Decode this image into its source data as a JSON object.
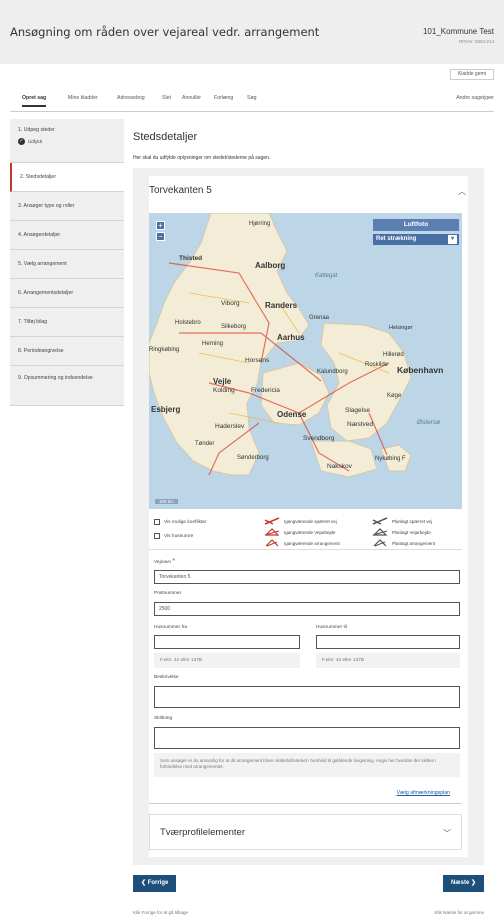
{
  "header": {
    "title": "Ansøgning om råden over vejareal vedr. arrangement",
    "user": "101_Kommune Test",
    "subuser": "RDVnr: 0004-214"
  },
  "kladde_button": "Kladde gemt",
  "nav": {
    "items": [
      "Opret sag",
      "Mine kladder",
      "Adressebog",
      "Slet",
      "Annullér",
      "Forlæng",
      "Søg"
    ],
    "right": "Andre sagstyper"
  },
  "steps": [
    {
      "label": "1. Udpeg steder",
      "sub": "Udfyldt"
    },
    {
      "label": "2. Stedsdetaljer"
    },
    {
      "label": "3. Ansøger type og roller"
    },
    {
      "label": "4. Ansøgerdetaljer"
    },
    {
      "label": "5. Vælg arrangement"
    },
    {
      "label": "6. Arrangementsdetaljer"
    },
    {
      "label": "7. Tilføj bilag"
    },
    {
      "label": "8. Periodeangivelse"
    },
    {
      "label": "9. Opsummering og indsendelse"
    }
  ],
  "main": {
    "title": "Stedsdetaljer",
    "description": "Her skal du udfylde oplysninger om stedet/stederne på sagen."
  },
  "location": {
    "title": "Torvekanten 5"
  },
  "map": {
    "luftfoto": "Luftfoto",
    "retning": "Ret strækning",
    "places": [
      "Hjørring",
      "Thisted",
      "Aalborg",
      "Kattegat",
      "Viborg",
      "Randers",
      "Holstebro",
      "Silkeborg",
      "Grenaa",
      "Herning",
      "Aarhus",
      "Helsingør",
      "Ringkøbing",
      "Horsens",
      "Hillerød",
      "Kalundborg",
      "Roskilde",
      "København",
      "Vejle",
      "Kolding",
      "Fredericia",
      "Køge",
      "Esbjerg",
      "Odense",
      "Slagelse",
      "Næstved",
      "Haderslev",
      "Østersø",
      "Tønder",
      "Svendborg",
      "Sønderborg",
      "Nakskov",
      "Nykøbing F"
    ],
    "scale": "100 km"
  },
  "legend": {
    "checkbox1": "Vis mulige konflikter",
    "checkbox2": "Vis husnumre",
    "items": [
      "Igangværende spærret vej",
      "Igangværende Vejarbejde",
      "Igangværende arrangement",
      "Planlagt spærret vej",
      "Planlagt Vejarbejde",
      "Planlagt arrangement"
    ]
  },
  "form": {
    "vejnavn_label": "Vejnavn",
    "vejnavn_value": "Torvekanten 5",
    "postnummer_label": "Postnummer",
    "postnummer_value": "2500",
    "husnr_fra_label": "Husnummer fra",
    "husnr_til_label": "Husnummer til",
    "hint_fra": "F.eks: 42 eller 137B",
    "hint_til": "F.eks: 42 eller 137B",
    "beskrivelse_label": "Beskrivelse",
    "skiltning_label": "Skiltning",
    "skiltning_hint": "Som ansøger er du ansvarlig for at dit arrangement bliver skiltet/afmærket i henhold til gældende lovgivning. Angiv her hvordan der skiltes i forbindelse med arrangementet."
  },
  "link": "Vælg afmærkningsplan",
  "accordion2": "Tværprofilelementer",
  "buttons": {
    "prev": "Forrige",
    "next": "Næste"
  },
  "footer": {
    "left": "Klik Forrige for at gå tilbage",
    "right": "Klik Næste for at gemme"
  },
  "colors": {
    "primary_button": "#1e4f7a",
    "active_step": "#c0392b",
    "link": "#1f5aa6"
  }
}
